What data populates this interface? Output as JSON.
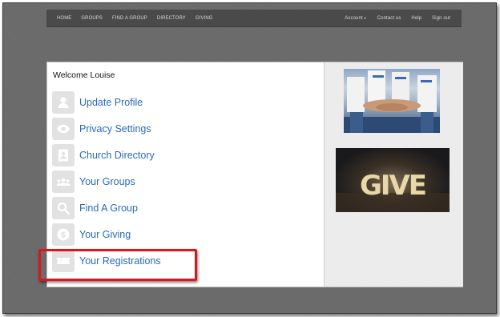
{
  "nav": {
    "left": [
      "HOME",
      "GROUPS",
      "FIND A GROUP",
      "DIRECTORY",
      "GIVING"
    ],
    "right": {
      "account": "Account",
      "contact": "Contact us",
      "help": "Help",
      "signout": "Sign out"
    }
  },
  "main": {
    "welcome": "Welcome Louise",
    "menu": [
      {
        "label": "Update Profile",
        "icon": "user-icon"
      },
      {
        "label": "Privacy Settings",
        "icon": "eye-icon"
      },
      {
        "label": "Church Directory",
        "icon": "address-book-icon"
      },
      {
        "label": "Your Groups",
        "icon": "group-icon"
      },
      {
        "label": "Find A Group",
        "icon": "magnifier-icon"
      },
      {
        "label": "Your Giving",
        "icon": "dollar-icon"
      },
      {
        "label": "Your Registrations",
        "icon": "ticket-icon"
      }
    ]
  },
  "side": {
    "give_text": "GIVE"
  },
  "colors": {
    "link": "#2a6ab9",
    "highlight": "#e0141b",
    "navbar": "#4a4a4a",
    "backdrop": "#6a6a6a"
  }
}
